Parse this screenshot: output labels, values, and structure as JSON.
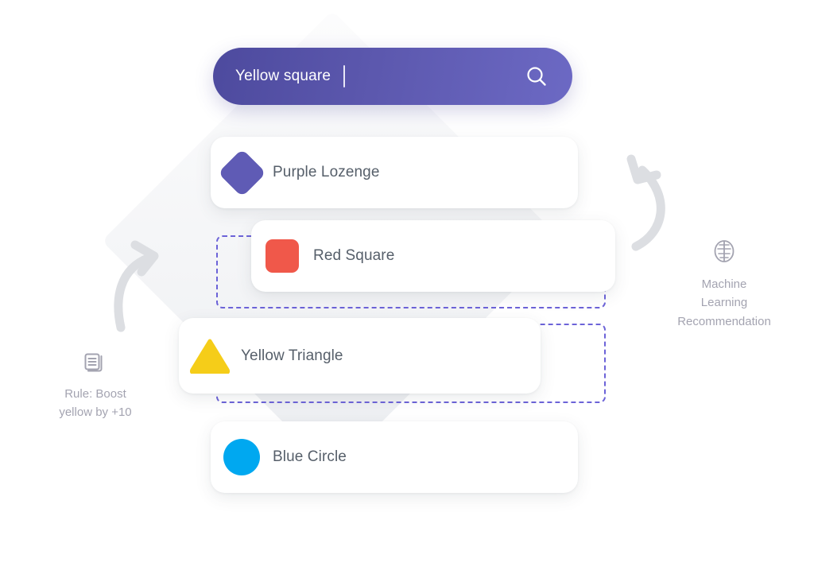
{
  "search": {
    "query": "Yellow square",
    "icon": "search-icon",
    "caret_visible": true,
    "gradient_from": "#4d4a9e",
    "gradient_to": "#6c69c4"
  },
  "results": [
    {
      "label": "Purple Lozenge",
      "shape": "lozenge",
      "color": "#5f5bb5"
    },
    {
      "label": "Red Square",
      "shape": "square",
      "color": "#f0584a"
    },
    {
      "label": "Yellow Triangle",
      "shape": "triangle",
      "color": "#f5cd19"
    },
    {
      "label": "Blue Circle",
      "shape": "circle",
      "color": "#00a8f0"
    }
  ],
  "annotations": {
    "left": {
      "icon": "rules-document-icon",
      "line1": "Rule: Boost",
      "line2": "yellow by +10",
      "color": "#6b6b80"
    },
    "right": {
      "icon": "brain-icon",
      "line1": "Machine",
      "line2": "Learning",
      "line3": "Recommendation",
      "color": "#6b6b80"
    }
  },
  "decor": {
    "dashed_border_color": "#6c63d8",
    "arrow_color": "#dcdee2",
    "diamond_color": "#f2f3f5"
  }
}
